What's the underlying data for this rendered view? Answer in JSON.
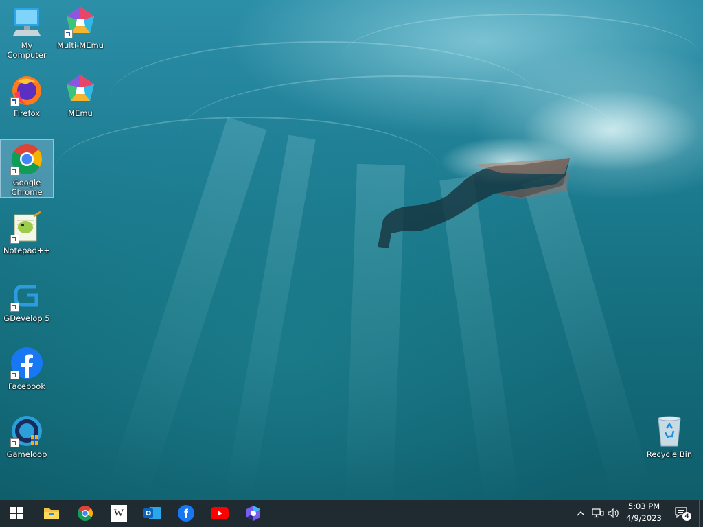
{
  "desktop": {
    "icons": [
      {
        "label": "My Computer",
        "icon": "computer-icon",
        "shortcut": false
      },
      {
        "label": "Multi-MEmu",
        "icon": "multi-memu-icon",
        "shortcut": true
      },
      {
        "label": "Firefox",
        "icon": "firefox-icon",
        "shortcut": true
      },
      {
        "label": "MEmu",
        "icon": "memu-icon",
        "shortcut": true
      },
      {
        "label": "Google Chrome",
        "icon": "chrome-icon",
        "shortcut": true,
        "selected": true
      },
      {
        "label": "Notepad++",
        "icon": "notepadpp-icon",
        "shortcut": true
      },
      {
        "label": "GDevelop 5",
        "icon": "gdevelop-icon",
        "shortcut": true
      },
      {
        "label": "Facebook",
        "icon": "facebook-icon",
        "shortcut": true
      },
      {
        "label": "Gameloop",
        "icon": "gameloop-icon",
        "shortcut": true
      },
      {
        "label": "Recycle Bin",
        "icon": "recycle-bin-icon",
        "shortcut": false
      }
    ]
  },
  "taskbar": {
    "pinned": [
      {
        "name": "start",
        "icon": "windows-start-icon"
      },
      {
        "name": "file-explorer",
        "icon": "folder-icon"
      },
      {
        "name": "chrome",
        "icon": "chrome-icon"
      },
      {
        "name": "wikipedia",
        "icon": "wikipedia-icon",
        "glyph": "W"
      },
      {
        "name": "outlook",
        "icon": "outlook-icon",
        "glyph": "O"
      },
      {
        "name": "facebook",
        "icon": "facebook-icon",
        "glyph": "f"
      },
      {
        "name": "youtube",
        "icon": "youtube-icon"
      },
      {
        "name": "clipchamp",
        "icon": "clipchamp-icon"
      }
    ],
    "tray": {
      "overflow_icon": "chevron-up-icon",
      "network_icon": "network-icon",
      "volume_icon": "speaker-icon",
      "time": "5:03 PM",
      "date": "4/9/2023",
      "notifications_count": "4"
    }
  },
  "colors": {
    "taskbar": "#1f2a31",
    "water_top": "#2c8fa8",
    "water_bottom": "#0f5e6c"
  }
}
